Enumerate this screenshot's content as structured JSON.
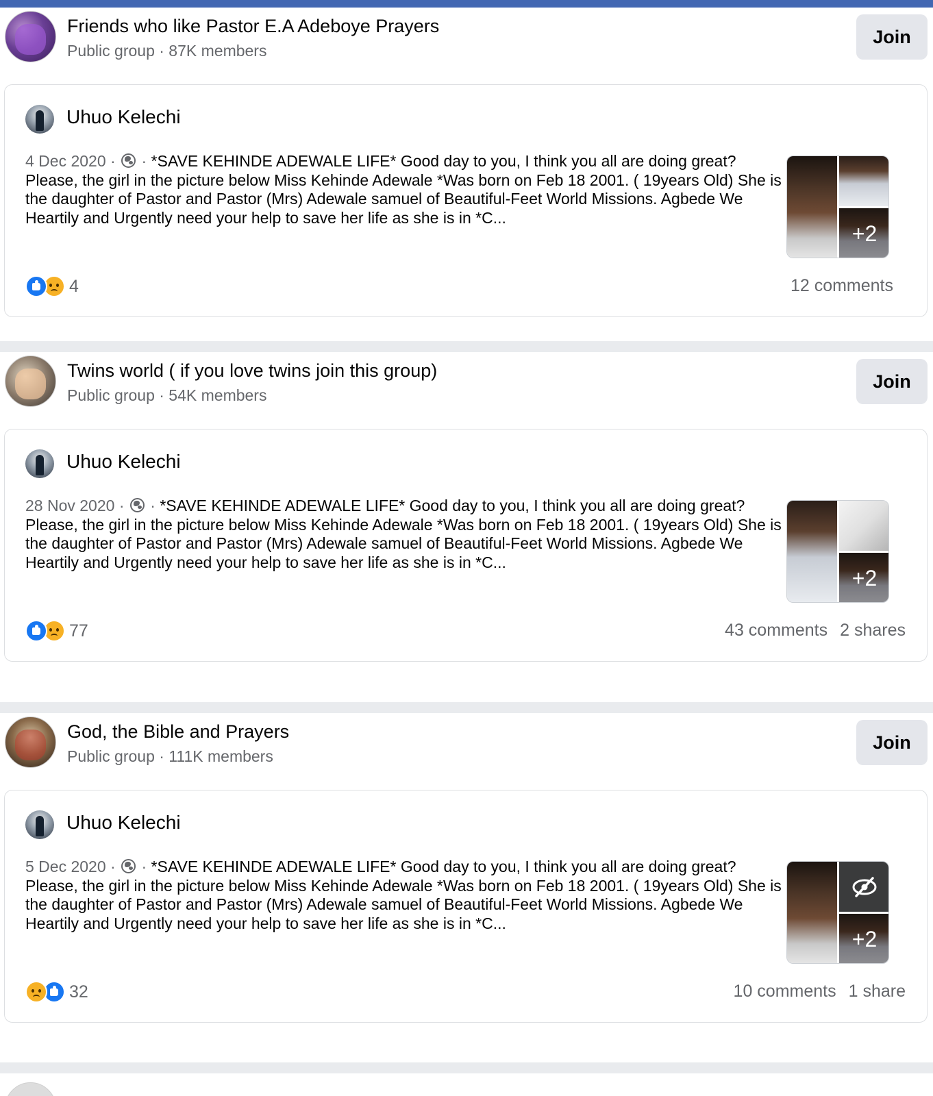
{
  "groups": [
    {
      "name": "Friends who like Pastor E.A Adeboye Prayers",
      "meta": "Public group · 87K members",
      "join_label": "Join",
      "post": {
        "author": "Uhuo Kelechi",
        "date": "4 Dec 2020",
        "text": "*SAVE KEHINDE ADEWALE  LIFE*  Good day to you, I think you all are doing great?  Please, the girl in the picture below Miss Kehinde Adewale *Was born on Feb 18 2001. ( 19years Old)  She is the daughter of Pastor and Pastor (Mrs) Adewale samuel  of Beautiful-Feet World Missions. Agbede  We Heartily and Urgently need your help to save her life as she is in *C...",
        "extra_photos": "+2",
        "reaction_count": "4",
        "comments": "12 comments",
        "shares": ""
      }
    },
    {
      "name": "Twins world ( if you love twins join this group)",
      "meta": "Public group · 54K members",
      "join_label": "Join",
      "post": {
        "author": "Uhuo Kelechi",
        "date": "28 Nov 2020",
        "text": "*SAVE KEHINDE ADEWALE  LIFE*  Good day to you, I think you all are doing great?  Please, the girl in the picture below Miss Kehinde Adewale *Was born on Feb 18 2001. ( 19years Old)  She is the daughter of Pastor and Pastor (Mrs) Adewale samuel  of Beautiful-Feet World Missions. Agbede  We Heartily and Urgently need your help to save her life as she is in *C...",
        "extra_photos": "+2",
        "reaction_count": "77",
        "comments": "43 comments",
        "shares": "2 shares"
      }
    },
    {
      "name": "God, the Bible and Prayers",
      "meta": "Public group · 111K members",
      "join_label": "Join",
      "post": {
        "author": "Uhuo Kelechi",
        "date": "5 Dec 2020",
        "text": "*SAVE KEHINDE ADEWALE  LIFE*  Good day to you, I think you all are doing great?  Please, the girl in the picture below Miss Kehinde Adewale *Was born on Feb 18 2001. ( 19years Old)  She is the daughter of Pastor and Pastor (Mrs) Adewale samuel  of Beautiful-Feet World Missions. Agbede  We Heartily and Urgently need your help to save her life as she is in *C...",
        "extra_photos": "+2",
        "reaction_count": "32",
        "comments": "10 comments",
        "shares": "1 share"
      }
    }
  ],
  "separator_dot": "·",
  "colors": {
    "accent_bar": "#4267b2",
    "join_bg": "#e4e6eb",
    "secondary_text": "#65676b",
    "like": "#1877f2",
    "sad": "#f7b125"
  },
  "icons": [
    "globe-icon",
    "like-icon",
    "sad-icon",
    "hidden-photo-icon"
  ]
}
